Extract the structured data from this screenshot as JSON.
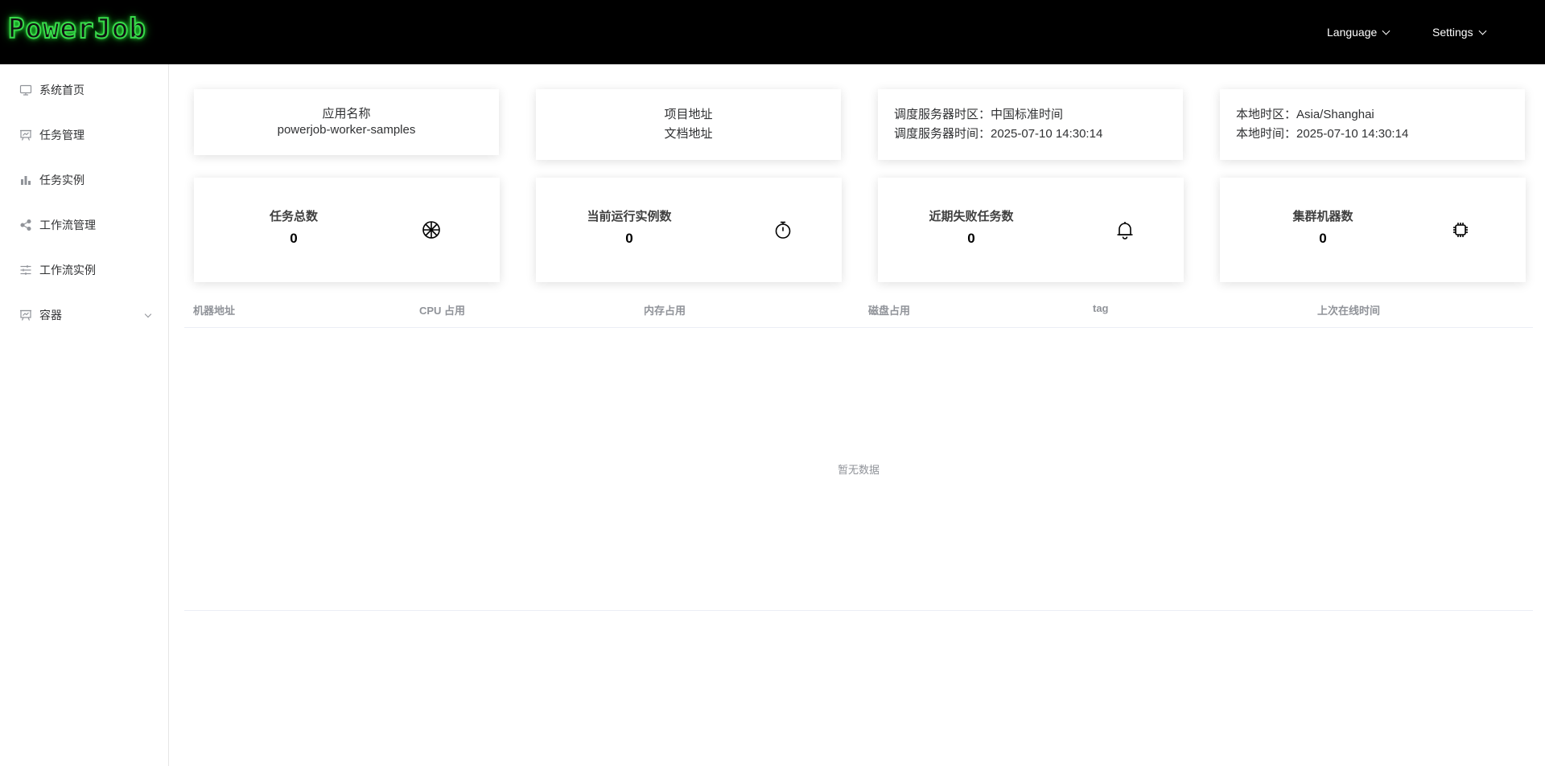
{
  "header": {
    "logo": "PowerJob",
    "language_label": "Language",
    "settings_label": "Settings"
  },
  "sidebar": {
    "items": [
      {
        "label": "系统首页",
        "icon": "monitor-icon"
      },
      {
        "label": "任务管理",
        "icon": "presentation-board-icon"
      },
      {
        "label": "任务实例",
        "icon": "bar-chart-icon"
      },
      {
        "label": "工作流管理",
        "icon": "share-icon"
      },
      {
        "label": "工作流实例",
        "icon": "sliders-icon"
      },
      {
        "label": "容器",
        "icon": "presentation-board-icon"
      }
    ]
  },
  "info": {
    "app_title": "应用名称",
    "app_name": "powerjob-worker-samples",
    "project_link": "项目地址",
    "docs_link": "文档地址",
    "server_tz": "调度服务器时区：中国标准时间",
    "server_time": "调度服务器时间：2025-07-10 14:30:14",
    "local_tz": "本地时区：Asia/Shanghai",
    "local_time": "本地时间：2025-07-10 14:30:14"
  },
  "stats": [
    {
      "label": "任务总数",
      "value": "0",
      "icon": "aperture-icon"
    },
    {
      "label": "当前运行实例数",
      "value": "0",
      "icon": "stopwatch-icon"
    },
    {
      "label": "近期失败任务数",
      "value": "0",
      "icon": "bell-icon"
    },
    {
      "label": "集群机器数",
      "value": "0",
      "icon": "cpu-chip-icon"
    }
  ],
  "table": {
    "columns": [
      "机器地址",
      "CPU 占用",
      "内存占用",
      "磁盘占用",
      "tag",
      "上次在线时间"
    ],
    "empty_text": "暂无数据"
  }
}
